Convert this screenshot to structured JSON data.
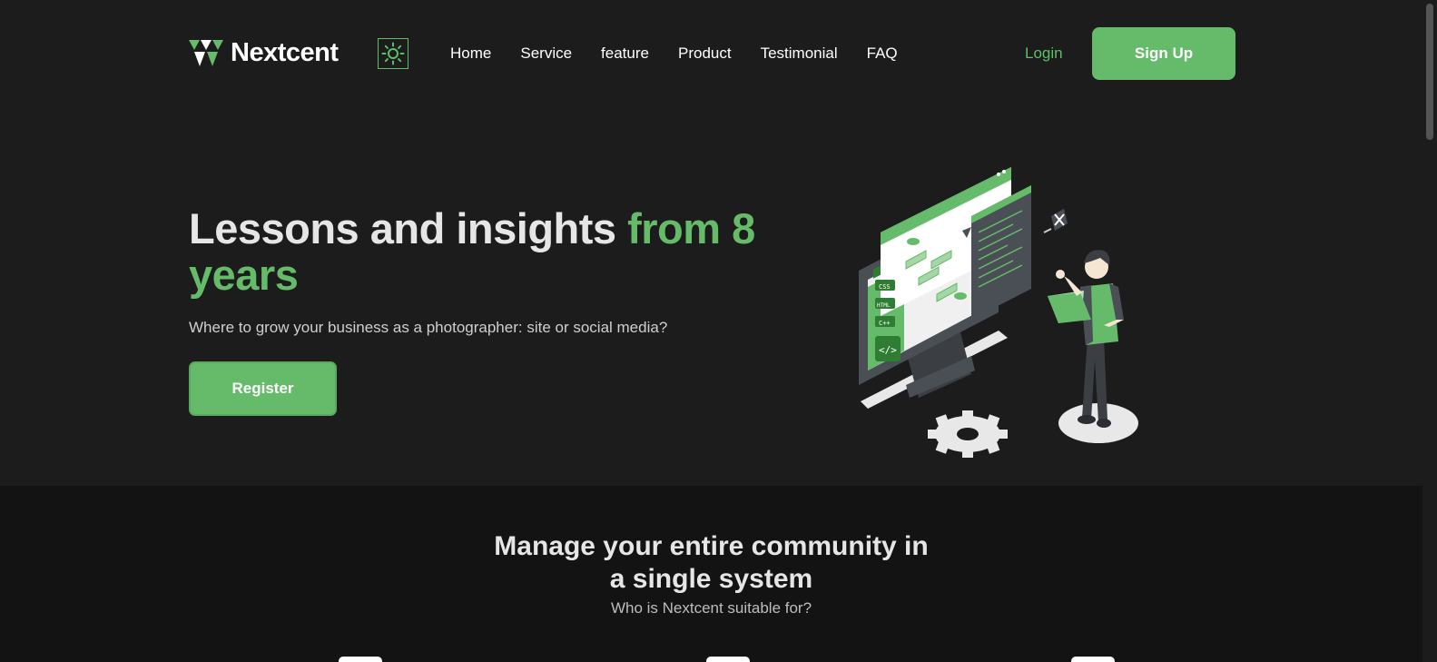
{
  "brand": {
    "name": "Nextcent",
    "accent": "#66bb6a"
  },
  "nav": {
    "items": [
      "Home",
      "Service",
      "feature",
      "Product",
      "Testimonial",
      "FAQ"
    ],
    "login_label": "Login",
    "signup_label": "Sign Up",
    "theme_icon": "sun-icon"
  },
  "hero": {
    "title_plain": "Lessons and insights ",
    "title_accent": "from 8 years",
    "subtitle": "Where to grow your business as a photographer: site or social media?",
    "cta_label": "Register",
    "illustration_labels": [
      "CSS",
      "HTML",
      "C++"
    ]
  },
  "community": {
    "title_line1": "Manage your entire community in",
    "title_line2": "a single system",
    "subtitle": "Who is Nextcent suitable for?"
  }
}
